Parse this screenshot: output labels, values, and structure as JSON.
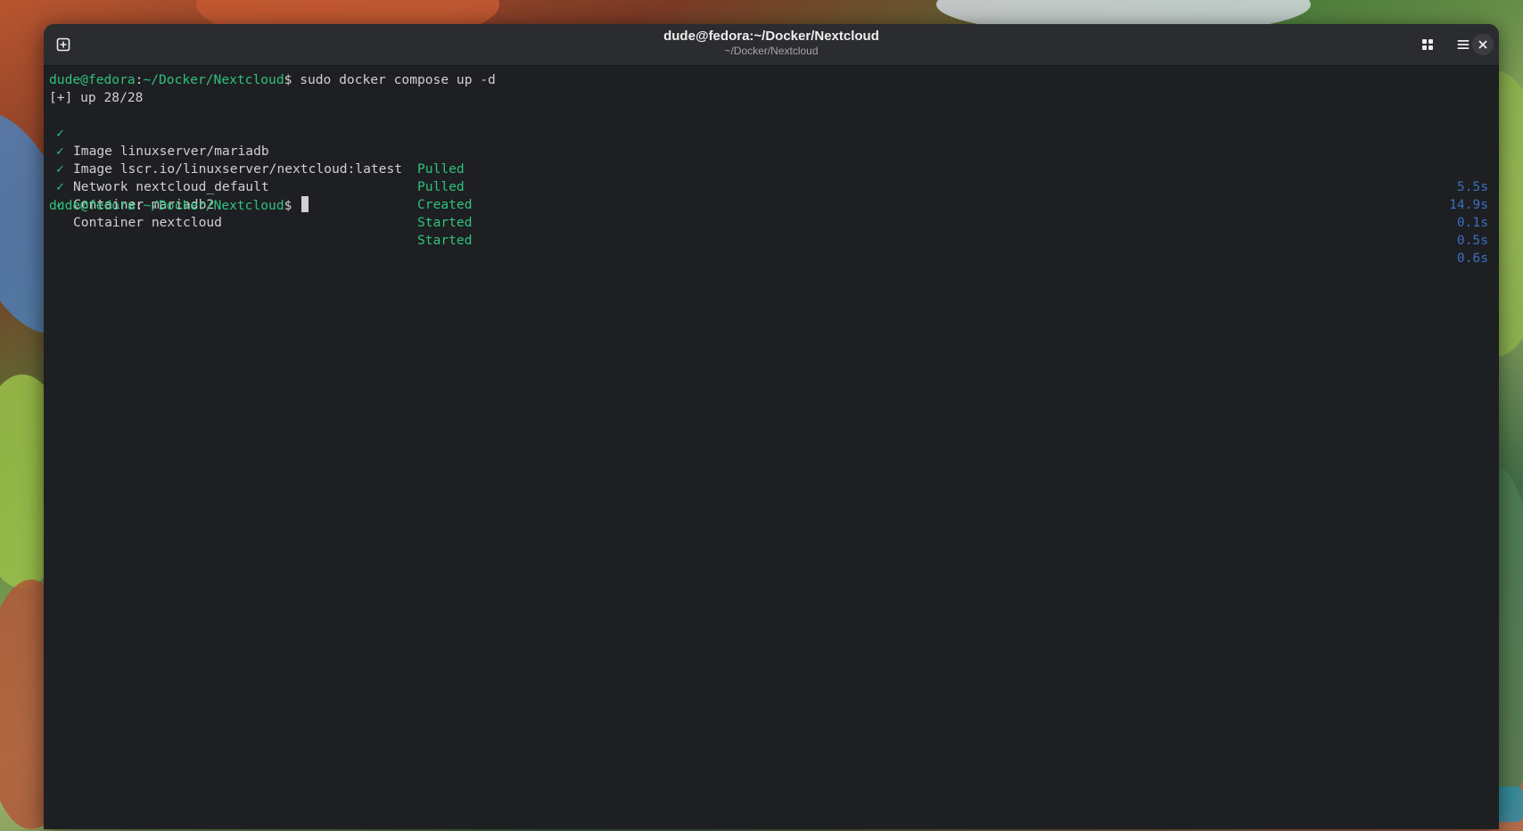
{
  "window": {
    "title": "dude@fedora:~/Docker/Nextcloud",
    "subtitle": "~/Docker/Nextcloud"
  },
  "colors": {
    "terminal_bg": "#1e1f22",
    "prompt_green": "#2ec27e",
    "duration_blue": "#3a6fc0",
    "text": "#d0d0d0"
  },
  "terminal": {
    "command_line": {
      "user_host": "dude@fedora",
      "colon": ":",
      "path": "~/Docker/Nextcloud",
      "dollar": "$",
      "command": " sudo docker compose up -d"
    },
    "summary_line": "[+] up 28/28",
    "check_mark": "✓",
    "resources": [
      {
        "name": "Image linuxserver/mariadb",
        "status": "Pulled",
        "duration": "5.5s"
      },
      {
        "name": "Image lscr.io/linuxserver/nextcloud:latest",
        "status": "Pulled",
        "duration": "14.9s"
      },
      {
        "name": "Network nextcloud_default",
        "status": "Created",
        "duration": "0.1s"
      },
      {
        "name": "Container mariadb2",
        "status": "Started",
        "duration": "0.5s"
      },
      {
        "name": "Container nextcloud",
        "status": "Started",
        "duration": "0.6s"
      }
    ],
    "final_prompt": {
      "user_host": "dude@fedora",
      "colon": ":",
      "path": "~/Docker/Nextcloud",
      "dollar": "$ "
    }
  }
}
